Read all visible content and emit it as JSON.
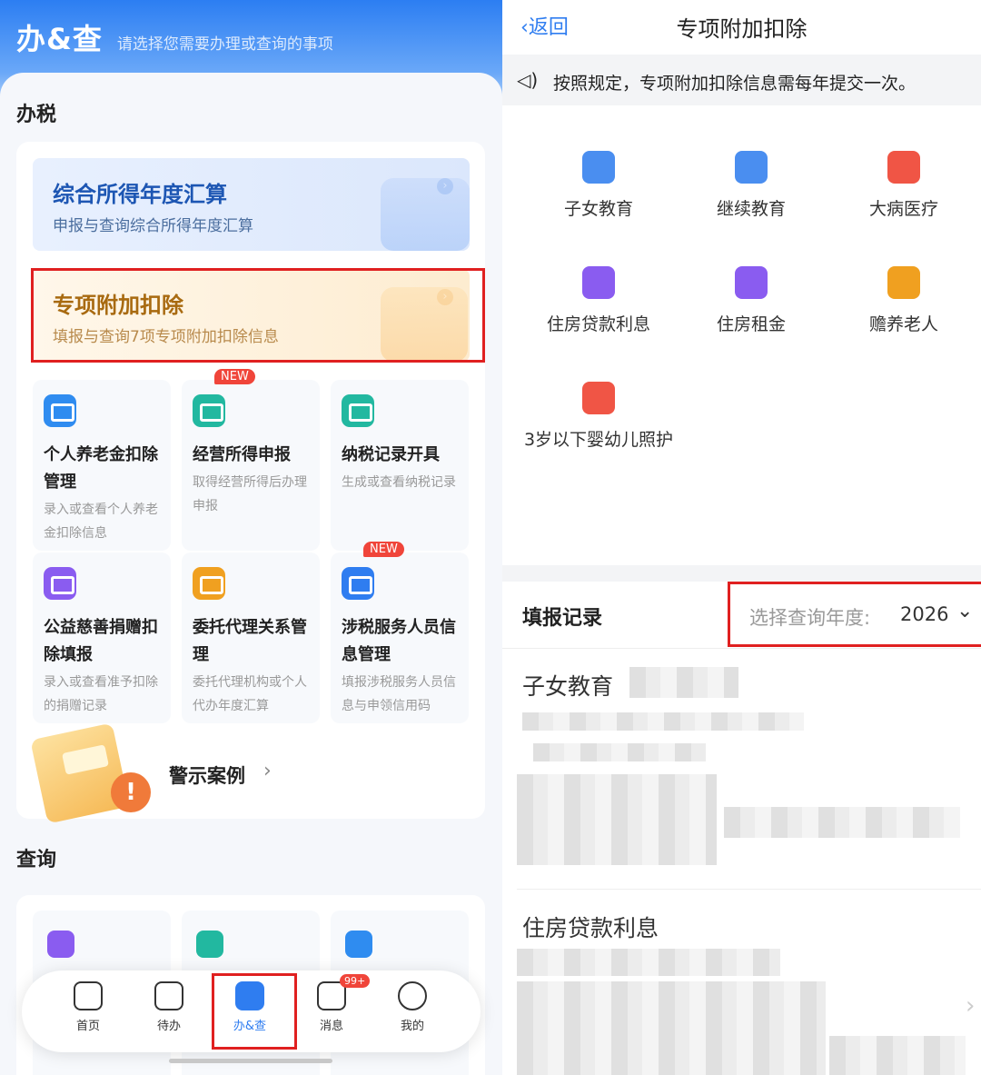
{
  "left": {
    "header": {
      "brand": "办&查",
      "subtitle": "请选择您需要办理或查询的事项"
    },
    "tax_section_title": "办税",
    "banner_annual": {
      "title": "综合所得年度汇算",
      "desc": "申报与查询综合所得年度汇算"
    },
    "banner_special": {
      "title": "专项附加扣除",
      "desc": "填报与查询7项专项附加扣除信息"
    },
    "tiles": [
      {
        "title": "个人养老金扣除管理",
        "desc": "录入或查看个人养老金扣除信息",
        "color": "#2f8cf0",
        "badge": ""
      },
      {
        "title": "经营所得申报",
        "desc": "取得经营所得后办理申报",
        "color": "#22b8a0",
        "badge": "NEW"
      },
      {
        "title": "纳税记录开具",
        "desc": "生成或查看纳税记录",
        "color": "#22b8a0",
        "badge": ""
      },
      {
        "title": "公益慈善捐赠扣除填报",
        "desc": "录入或查看准予扣除的捐赠记录",
        "color": "#8a5cf0",
        "badge": ""
      },
      {
        "title": "委托代理关系管理",
        "desc": "委托代理机构或个人代办年度汇算",
        "color": "#f0a020",
        "badge": ""
      },
      {
        "title": "涉税服务人员信息管理",
        "desc": "填报涉税服务人员信息与申领信用码",
        "color": "#2f7df0",
        "badge": "NEW"
      }
    ],
    "warning": {
      "label": "警示案例",
      "chevron": "›"
    },
    "query_section_title": "查询",
    "tabbar": [
      {
        "label": "首页",
        "icon": "home-icon"
      },
      {
        "label": "待办",
        "icon": "todo-icon"
      },
      {
        "label": "办&查",
        "icon": "handle-query-icon",
        "active": true
      },
      {
        "label": "消息",
        "icon": "message-icon",
        "badge": "99+"
      },
      {
        "label": "我的",
        "icon": "profile-icon"
      }
    ]
  },
  "right": {
    "nav": {
      "back": "返回",
      "title": "专项附加扣除"
    },
    "notice": "按照规定，专项附加扣除信息需每年提交一次。",
    "categories": [
      {
        "label": "子女教育",
        "icon": "books-icon",
        "color": "#4a8ef0"
      },
      {
        "label": "继续教育",
        "icon": "graduation-cap-icon",
        "color": "#4a8ef0"
      },
      {
        "label": "大病医疗",
        "icon": "medical-kit-icon",
        "color": "#f05545"
      },
      {
        "label": "住房贷款利息",
        "icon": "house-loan-icon",
        "color": "#8a5cf0"
      },
      {
        "label": "住房租金",
        "icon": "house-key-icon",
        "color": "#8a5cf0"
      },
      {
        "label": "赡养老人",
        "icon": "elderly-icon",
        "color": "#f0a020"
      },
      {
        "label": "3岁以下婴幼儿照护",
        "icon": "infant-care-icon",
        "color": "#f05545"
      }
    ],
    "records": {
      "title": "填报记录",
      "year_label": "选择查询年度:",
      "year_value": "2026",
      "items": [
        {
          "title": "子女教育"
        },
        {
          "title": "住房贷款利息"
        }
      ]
    }
  }
}
